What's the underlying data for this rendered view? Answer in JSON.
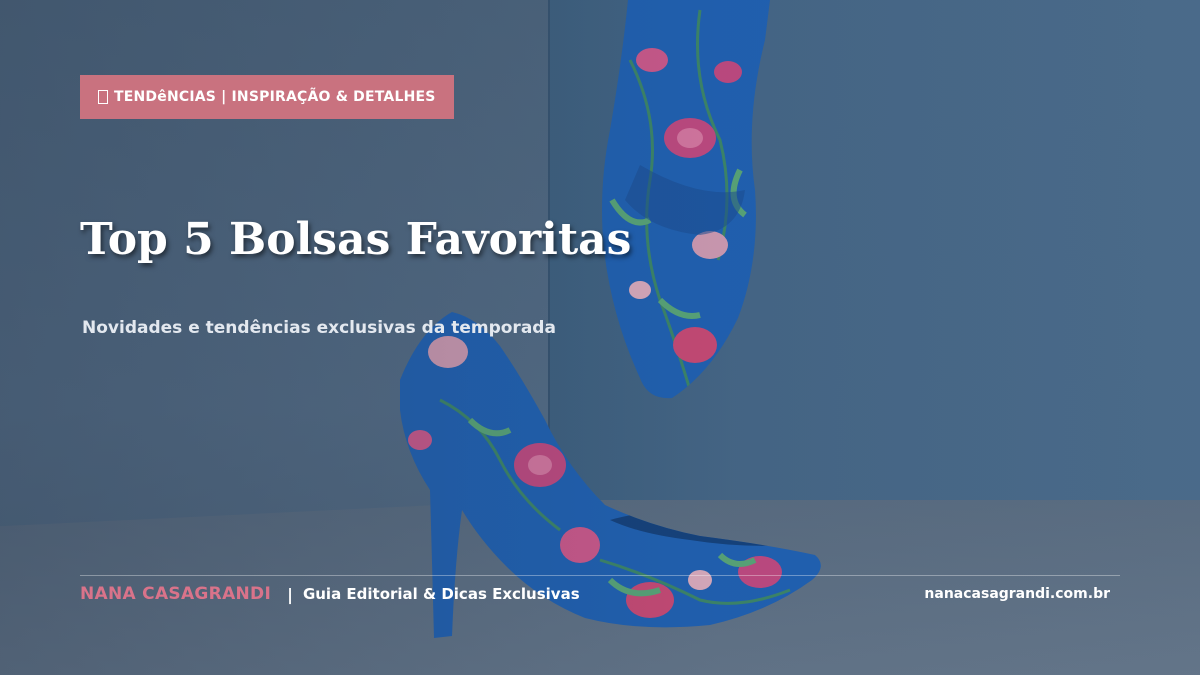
{
  "tag": {
    "icon": "bag-icon",
    "label": "TENDêNCIAS | INSPIRAÇÃO & DETALHES"
  },
  "hero": {
    "title": "Top 5 Bolsas Favoritas",
    "subtitle": "Novidades e tendências exclusivas da temporada"
  },
  "footer": {
    "brand": "NANA CASAGRANDI",
    "separator": "|",
    "tagline": "Guia Editorial & Dicas Exclusivas",
    "site": "nanacasagrandi.com.br"
  },
  "colors": {
    "accent": "#c9727f",
    "brand": "#d9738a",
    "background": "#546f89",
    "shoe_blue": "#1f63b8",
    "flower_pink": "#d14a77"
  }
}
